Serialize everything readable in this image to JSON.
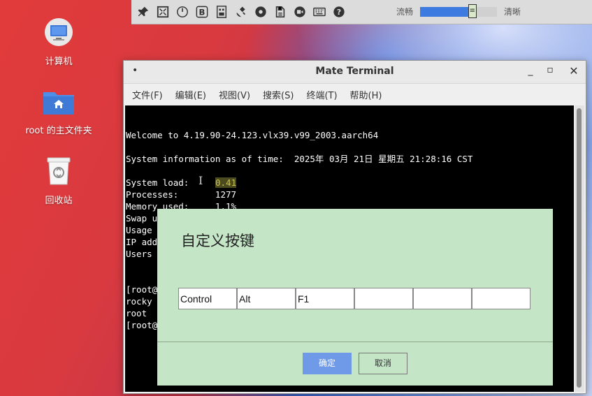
{
  "toolbar": {
    "icons": [
      "pin-icon",
      "fullscreen-icon",
      "power-icon",
      "bold-b-icon",
      "usb-icon",
      "satellite-icon",
      "disc-icon",
      "save-icon",
      "record-icon",
      "keyboard-icon",
      "help-icon"
    ],
    "quality_left": "流畅",
    "quality_right": "清晰",
    "quality_level": 0.68
  },
  "desktop": {
    "icons": [
      {
        "label": "计算机"
      },
      {
        "label": "root 的主文件夹"
      },
      {
        "label": "回收站"
      }
    ]
  },
  "terminal": {
    "title": "Mate Terminal",
    "menu": [
      "文件(F)",
      "编辑(E)",
      "视图(V)",
      "搜索(S)",
      "终端(T)",
      "帮助(H)"
    ],
    "lines": [
      "Welcome to 4.19.90-24.123.vlx39.v99_2003.aarch64",
      "System information as of time:  2025年 03月 21日 星期五 21:28:16 CST",
      "System load:",
      "0.41",
      "Processes:       1277",
      "Memory used:     1.1%",
      "Swap u",
      "Usage ",
      "IP add",
      "Users ",
      "[root@",
      "rocky",
      "root",
      "[root@"
    ]
  },
  "dialog": {
    "title": "自定义按键",
    "keys": [
      "Control",
      "Alt",
      "F1",
      "",
      "",
      ""
    ],
    "ok_label": "确定",
    "cancel_label": "取消"
  }
}
